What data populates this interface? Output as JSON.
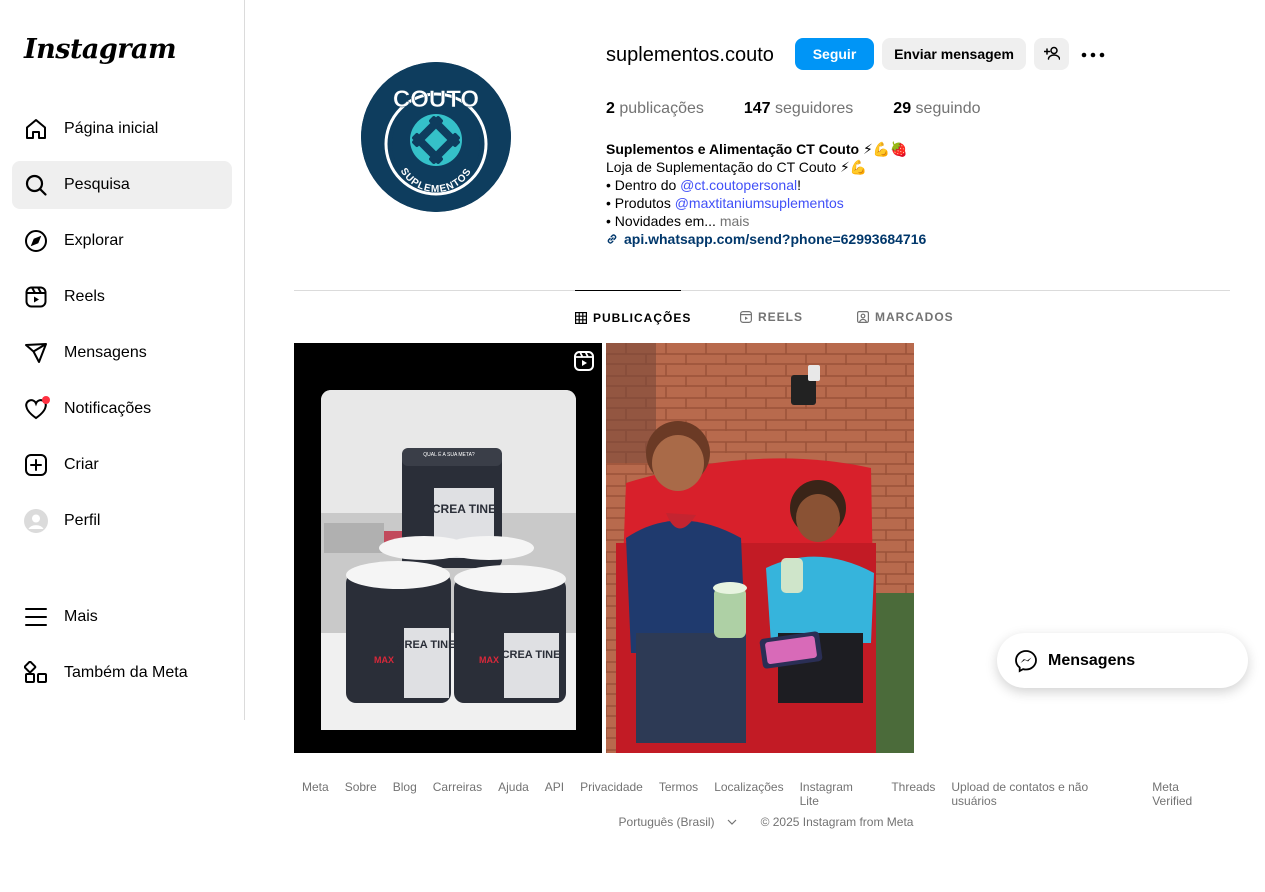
{
  "brand": {
    "logo_text": "Instagram"
  },
  "sidebar": {
    "items": [
      {
        "label": "Página inicial",
        "icon": "home-icon"
      },
      {
        "label": "Pesquisa",
        "icon": "search-icon"
      },
      {
        "label": "Explorar",
        "icon": "compass-icon"
      },
      {
        "label": "Reels",
        "icon": "reels-icon"
      },
      {
        "label": "Mensagens",
        "icon": "send-icon"
      },
      {
        "label": "Notificações",
        "icon": "heart-icon"
      },
      {
        "label": "Criar",
        "icon": "plus-square-icon"
      },
      {
        "label": "Perfil",
        "icon": "avatar-icon"
      },
      {
        "label": "Mais",
        "icon": "menu-icon"
      },
      {
        "label": "Também da Meta",
        "icon": "meta-apps-icon"
      }
    ]
  },
  "profile": {
    "username": "suplementos.couto",
    "avatar_text_top": "COUTO",
    "avatar_text_bottom": "SUPLEMENTOS",
    "follow_label": "Seguir",
    "message_label": "Enviar mensagem",
    "stats": {
      "posts_count": "2",
      "posts_label": "publicações",
      "followers_count": "147",
      "followers_label": "seguidores",
      "following_count": "29",
      "following_label": "seguindo"
    },
    "bio": {
      "name": "Suplementos e Alimentação CT Couto ⚡💪🍓",
      "line1": "Loja de Suplementação do CT Couto ⚡💪",
      "line2_prefix": "• Dentro do ",
      "line2_mention": "@ct.coutopersonal",
      "line2_suffix": "!",
      "line3_prefix": "• Produtos ",
      "line3_mention": "@maxtitaniumsuplementos",
      "line4": "• Novidades em...",
      "more": "mais",
      "link": "api.whatsapp.com/send?phone=62993684716"
    }
  },
  "tabs": [
    {
      "label": "PUBLICAÇÕES",
      "icon": "grid-icon",
      "active": true
    },
    {
      "label": "REELS",
      "icon": "reels-icon",
      "active": false
    },
    {
      "label": "MARCADOS",
      "icon": "tagged-icon",
      "active": false
    }
  ],
  "posts": {
    "post1": {
      "jar_text": "CREA TINE",
      "jar_top_text": "QUAL É A SUA META?",
      "brand": "MAX",
      "is_reel": true
    },
    "post2": {
      "is_reel": false
    }
  },
  "footer": {
    "links": [
      "Meta",
      "Sobre",
      "Blog",
      "Carreiras",
      "Ajuda",
      "API",
      "Privacidade",
      "Termos",
      "Localizações",
      "Instagram Lite",
      "Threads",
      "Upload de contatos e não usuários",
      "Meta Verified"
    ],
    "language": "Português (Brasil)",
    "copyright": "© 2025 Instagram from Meta"
  },
  "floating_messages": {
    "label": "Mensagens"
  },
  "colors": {
    "primary": "#0095f6",
    "link": "#00376b",
    "mention": "#4150f7",
    "muted": "#737373",
    "notification": "#ff3040",
    "avatar_bg": "#0e3d5e",
    "avatar_accent": "#35c1c9"
  }
}
